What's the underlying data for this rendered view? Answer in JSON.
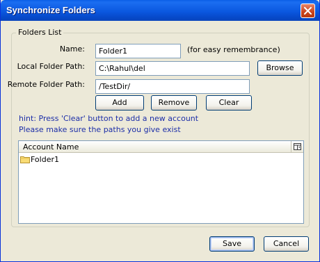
{
  "window": {
    "title": "Synchronize Folders"
  },
  "folders_list": {
    "legend": "Folders List",
    "name_label": "Name:",
    "name_value": "Folder1",
    "name_hint": "(for easy remembrance)",
    "local_label": "Local Folder Path:",
    "local_value": "C:\\Rahul\\del",
    "browse_label": "Browse",
    "remote_label": "Remote Folder Path:",
    "remote_value": "/TestDir/",
    "add_label": "Add",
    "remove_label": "Remove",
    "clear_label": "Clear",
    "hint_1": "hint: Press 'Clear' button to add a new account",
    "hint_2": "Please make sure the paths you give exist"
  },
  "table": {
    "columns": [
      "Account Name"
    ],
    "rows": [
      {
        "name": "Folder1",
        "icon": "folder-icon"
      }
    ],
    "corner_icon": "column-picker-icon"
  },
  "footer": {
    "save_label": "Save",
    "cancel_label": "Cancel"
  },
  "colors": {
    "titlebar": "#0a5de6",
    "dialog_bg": "#ece9d8",
    "hint_text": "#1c2ea8",
    "close_button": "#c8421c"
  }
}
